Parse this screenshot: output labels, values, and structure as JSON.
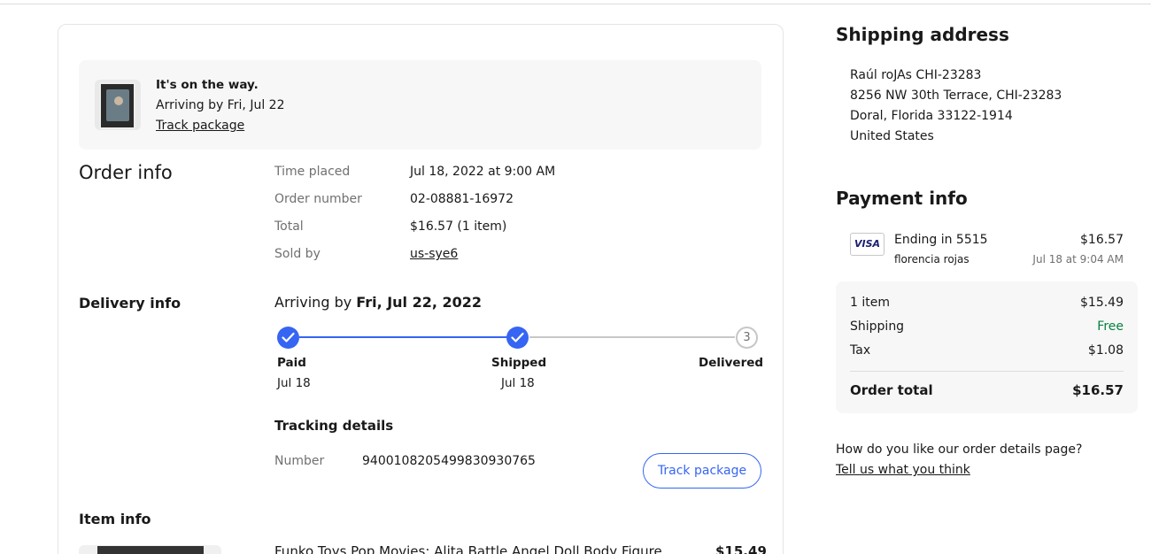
{
  "banner": {
    "status": "It's on the way.",
    "arriving": "Arriving by Fri, Jul 22",
    "track_link": "Track package"
  },
  "order_info": {
    "heading": "Order info",
    "rows": [
      {
        "label": "Time placed",
        "value": "Jul 18, 2022 at 9:00 AM"
      },
      {
        "label": "Order number",
        "value": "02-08881-16972"
      },
      {
        "label": "Total",
        "value": "$16.57 (1 item)"
      },
      {
        "label": "Sold by",
        "value": "us-sye6"
      }
    ]
  },
  "delivery_info": {
    "heading": "Delivery info",
    "arriving_prefix": "Arriving by",
    "arriving_date": "Fri, Jul 22, 2022",
    "steps": [
      {
        "label": "Paid",
        "date": "Jul 18",
        "state": "done"
      },
      {
        "label": "Shipped",
        "date": "Jul 18",
        "state": "done"
      },
      {
        "label": "Delivered",
        "date": "",
        "state": "pending",
        "number": "3"
      }
    ],
    "tracking_heading": "Tracking details",
    "tracking_label": "Number",
    "tracking_number": "9400108205499830930765",
    "track_button": "Track package"
  },
  "item_info": {
    "heading": "Item info",
    "title": "Funko Toys Pop Movies: Alita Battle Angel Doll Body Figure",
    "price": "$15.49"
  },
  "shipping_address": {
    "heading": "Shipping address",
    "lines": [
      "Raúl roJAs CHI-23283",
      "8256 NW 30th Terrace, CHI-23283",
      "Doral, Florida 33122-1914",
      "United States"
    ]
  },
  "payment_info": {
    "heading": "Payment info",
    "card_brand": "VISA",
    "card_ending": "Ending in 5515",
    "card_holder": "florencia rojas",
    "amount": "$16.57",
    "date": "Jul 18 at 9:04 AM",
    "summary": [
      {
        "label": "1 item",
        "value": "$15.49"
      },
      {
        "label": "Shipping",
        "value": "Free"
      },
      {
        "label": "Tax",
        "value": "$1.08"
      }
    ],
    "total_label": "Order total",
    "total_value": "$16.57"
  },
  "feedback": {
    "question": "How do you like our order details page?",
    "link": "Tell us what you think"
  },
  "colors": {
    "accent": "#3665f3",
    "free_green": "#05823f",
    "muted": "#707070"
  }
}
